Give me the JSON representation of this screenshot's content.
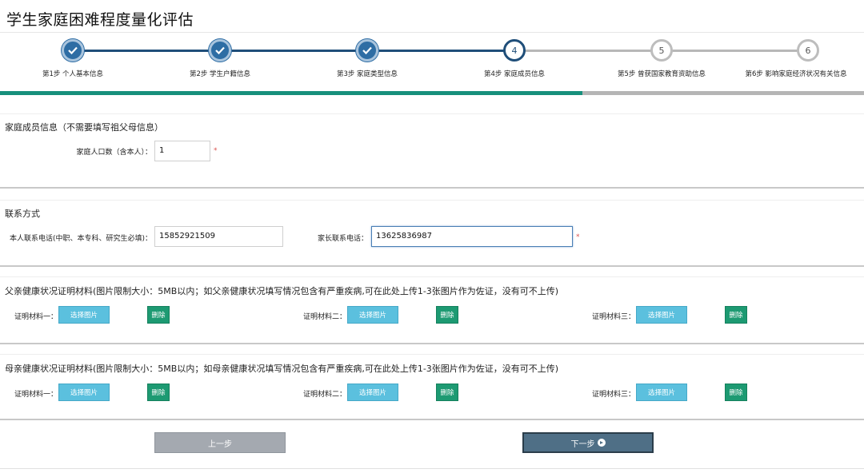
{
  "page": {
    "title": "学生家庭困难程度量化评估"
  },
  "steps": [
    {
      "number": "1",
      "label": "第1步 个人基本信息",
      "state": "done",
      "icon": "check-icon"
    },
    {
      "number": "2",
      "label": "第2步 学生户籍信息",
      "state": "done",
      "icon": "check-icon"
    },
    {
      "number": "3",
      "label": "第3步 家庭类型信息",
      "state": "done",
      "icon": "check-icon"
    },
    {
      "number": "4",
      "label": "第4步 家庭成员信息",
      "state": "active"
    },
    {
      "number": "5",
      "label": "第5步 曾获国家教育资助信息",
      "state": "todo"
    },
    {
      "number": "6",
      "label": "第6步 影响家庭经济状况有关信息",
      "state": "todo"
    }
  ],
  "progress": {
    "fraction": 0.674
  },
  "family": {
    "title": "家庭成员信息（不需要填写祖父母信息）",
    "count_label": "家庭人口数（含本人）：",
    "count_value": "1",
    "required_mark": "*"
  },
  "contact": {
    "title": "联系方式",
    "self_phone_label": "本人联系电话(中职、本专科、研究生必填)：",
    "self_phone_value": "15852921509",
    "parent_phone_label": "家长联系电话：",
    "parent_phone_value": "13625836987",
    "required_mark": "*"
  },
  "father_materials": {
    "title": "父亲健康状况证明材料(图片限制大小：5MB以内；如父亲健康状况填写情况包含有严重疾病,可在此处上传1-3张图片作为佐证，没有可不上传)",
    "items": [
      {
        "label": "证明材料一：",
        "choose": "选择图片",
        "delete": "删除"
      },
      {
        "label": "证明材料二：",
        "choose": "选择图片",
        "delete": "删除"
      },
      {
        "label": "证明材料三：",
        "choose": "选择图片",
        "delete": "删除"
      }
    ]
  },
  "mother_materials": {
    "title": "母亲健康状况证明材料(图片限制大小：5MB以内；如母亲健康状况填写情况包含有严重疾病,可在此处上传1-3张图片作为佐证，没有可不上传)",
    "items": [
      {
        "label": "证明材料一：",
        "choose": "选择图片",
        "delete": "删除"
      },
      {
        "label": "证明材料二：",
        "choose": "选择图片",
        "delete": "删除"
      },
      {
        "label": "证明材料三：",
        "choose": "选择图片",
        "delete": "删除"
      }
    ]
  },
  "nav": {
    "prev_label": "上一步",
    "next_label": "下一步",
    "next_icon": "arrow-circle-right-icon"
  },
  "colors": {
    "step_done": "#2e6da4",
    "step_line": "#1f4e79",
    "progress_fill": "#17907c",
    "choose_button": "#5bc0de",
    "delete_button": "#1d9a72",
    "required": "#d9534f"
  }
}
